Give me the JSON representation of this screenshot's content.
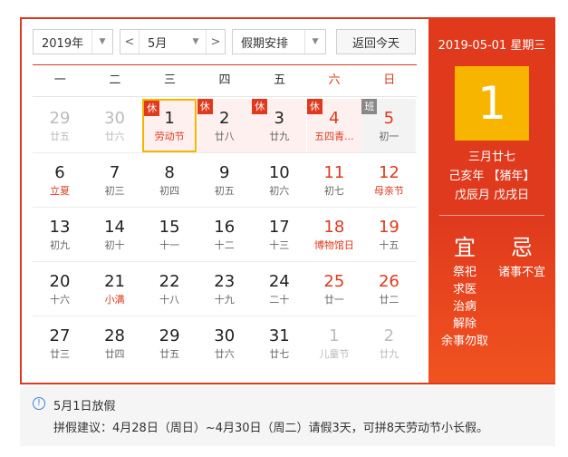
{
  "toolbar": {
    "year": "2019年",
    "prev": "<",
    "month": "5月",
    "next": ">",
    "holiday": "假期安排",
    "today": "返回今天"
  },
  "weekdays": [
    "一",
    "二",
    "三",
    "四",
    "五",
    "六",
    "日"
  ],
  "weeks": [
    [
      {
        "num": "29",
        "sub": "廿五",
        "muted": true
      },
      {
        "num": "30",
        "sub": "廿六",
        "muted": true
      },
      {
        "num": "1",
        "sub": "劳动节",
        "badge": "休",
        "fest": true,
        "selected": true,
        "rest": true
      },
      {
        "num": "2",
        "sub": "廿八",
        "badge": "休",
        "rest": true
      },
      {
        "num": "3",
        "sub": "廿九",
        "badge": "休",
        "rest": true
      },
      {
        "num": "4",
        "sub": "五四青...",
        "badge": "休",
        "rest": true,
        "we": true,
        "fest": true
      },
      {
        "num": "5",
        "sub": "初一",
        "badge": "班",
        "work": true,
        "we": true
      }
    ],
    [
      {
        "num": "6",
        "sub": "立夏",
        "fest": true
      },
      {
        "num": "7",
        "sub": "初三"
      },
      {
        "num": "8",
        "sub": "初四"
      },
      {
        "num": "9",
        "sub": "初五"
      },
      {
        "num": "10",
        "sub": "初六"
      },
      {
        "num": "11",
        "sub": "初七",
        "we": true
      },
      {
        "num": "12",
        "sub": "母亲节",
        "we": true,
        "fest": true
      }
    ],
    [
      {
        "num": "13",
        "sub": "初九"
      },
      {
        "num": "14",
        "sub": "初十"
      },
      {
        "num": "15",
        "sub": "十一"
      },
      {
        "num": "16",
        "sub": "十二"
      },
      {
        "num": "17",
        "sub": "十三"
      },
      {
        "num": "18",
        "sub": "博物馆日",
        "we": true,
        "fest": true
      },
      {
        "num": "19",
        "sub": "十五",
        "we": true
      }
    ],
    [
      {
        "num": "20",
        "sub": "十六"
      },
      {
        "num": "21",
        "sub": "小满",
        "fest": true
      },
      {
        "num": "22",
        "sub": "十八"
      },
      {
        "num": "23",
        "sub": "十九"
      },
      {
        "num": "24",
        "sub": "二十"
      },
      {
        "num": "25",
        "sub": "廿一",
        "we": true
      },
      {
        "num": "26",
        "sub": "廿二",
        "we": true
      }
    ],
    [
      {
        "num": "27",
        "sub": "廿三"
      },
      {
        "num": "28",
        "sub": "廿四"
      },
      {
        "num": "29",
        "sub": "廿五"
      },
      {
        "num": "30",
        "sub": "廿六"
      },
      {
        "num": "31",
        "sub": "廿七"
      },
      {
        "num": "1",
        "sub": "儿童节",
        "muted": true
      },
      {
        "num": "2",
        "sub": "廿九",
        "muted": true
      }
    ]
  ],
  "detail": {
    "date": "2019-05-01 星期三",
    "day": "1",
    "lunar1": "三月廿七",
    "lunar2": "己亥年 【猪年】",
    "lunar3": "戊辰月 戊戌日",
    "yi": "宜",
    "ji": "忌",
    "yi_items": [
      "祭祀",
      "求医",
      "治病",
      "解除",
      "余事勿取"
    ],
    "ji_items": [
      "诸事不宜"
    ]
  },
  "info": {
    "icon": "info-icon",
    "title": "5月1日放假",
    "text": "拼假建议：4月28日（周日）~4月30日（周二）请假3天，可拼8天劳动节小长假。"
  },
  "colors": {
    "accent": "#e0391c",
    "highlight": "#f7b500",
    "info": "#3a86d6"
  }
}
